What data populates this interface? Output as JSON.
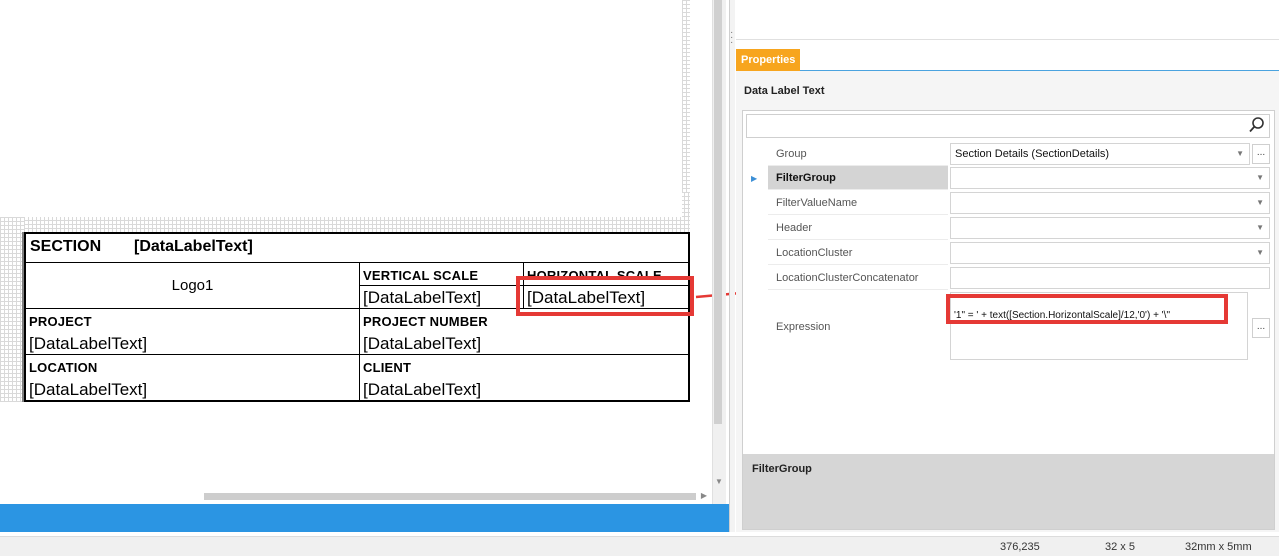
{
  "designer": {
    "title_block": {
      "section_label": "SECTION",
      "section_value": "[DataLabelText]",
      "logo": "Logo1",
      "vertical_scale_label": "VERTICAL SCALE",
      "vertical_scale_value": "[DataLabelText]",
      "horizontal_scale_label": "HORIZONTAL SCALE",
      "horizontal_scale_value": "[DataLabelText]",
      "project_label": "PROJECT",
      "project_value": "[DataLabelText]",
      "project_number_label": "PROJECT NUMBER",
      "project_number_value": "[DataLabelText]",
      "location_label": "LOCATION",
      "location_value": "[DataLabelText]",
      "client_label": "CLIENT",
      "client_value": "[DataLabelText]"
    }
  },
  "properties": {
    "tab_label": "Properties",
    "panel_title": "Data Label Text",
    "search": {
      "value": "",
      "placeholder": ""
    },
    "rows": [
      {
        "name": "Group",
        "value": "Section Details (SectionDetails)",
        "has_dropdown": true,
        "has_ellipsis": true
      },
      {
        "name": "FilterGroup",
        "value": "",
        "has_dropdown": true,
        "selected": true
      },
      {
        "name": "FilterValueName",
        "value": "",
        "has_dropdown": true
      },
      {
        "name": "Header",
        "value": "",
        "has_dropdown": true
      },
      {
        "name": "LocationCluster",
        "value": "",
        "has_dropdown": true
      },
      {
        "name": "LocationClusterConcatenator",
        "value": ""
      }
    ],
    "expression": {
      "name": "Expression",
      "value": "'1\" = ' + text([Section.HorizontalScale]/12,'0') + '\\''",
      "ellipsis": "..."
    },
    "ellipsis": "...",
    "description_title": "FilterGroup"
  },
  "status_bar": {
    "position": "376,235",
    "size_grid": "32 x 5",
    "size_mm": "32mm x 5mm"
  },
  "colors": {
    "accent_blue": "#2b95e3",
    "tab_orange": "#f7a51e",
    "highlight_red": "#e53935"
  }
}
